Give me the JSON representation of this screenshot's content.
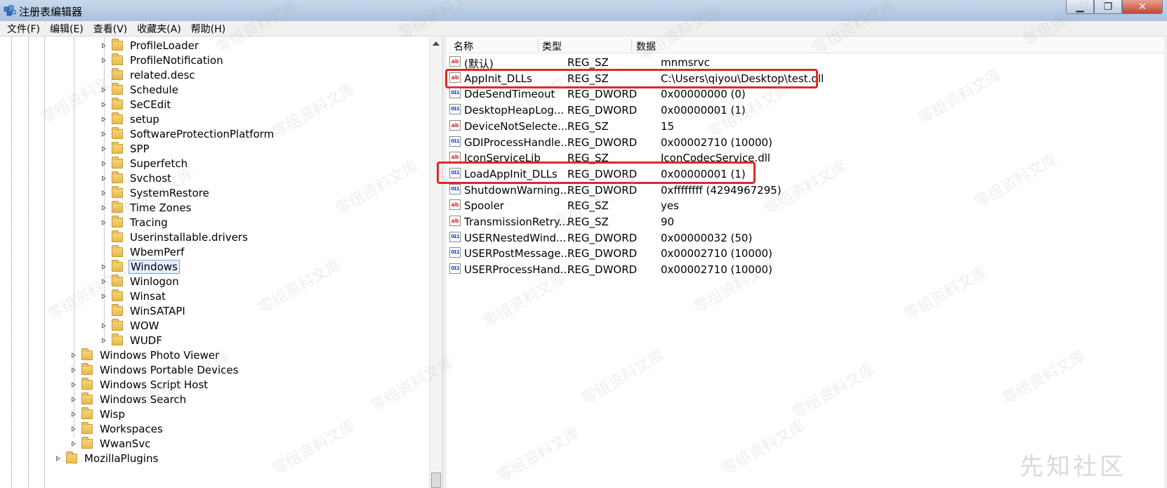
{
  "window": {
    "title": "注册表编辑器",
    "controls": {
      "minimize": "▁",
      "maximize": "❐",
      "close": "✕"
    }
  },
  "menu": [
    "文件(F)",
    "编辑(E)",
    "查看(V)",
    "收藏夹(A)",
    "帮助(H)"
  ],
  "tree": {
    "items": [
      {
        "label": "ProfileLoader",
        "expander": "closed"
      },
      {
        "label": "ProfileNotification",
        "expander": "closed"
      },
      {
        "label": "related.desc",
        "expander": "none"
      },
      {
        "label": "Schedule",
        "expander": "closed"
      },
      {
        "label": "SeCEdit",
        "expander": "closed"
      },
      {
        "label": "setup",
        "expander": "closed"
      },
      {
        "label": "SoftwareProtectionPlatform",
        "expander": "closed"
      },
      {
        "label": "SPP",
        "expander": "closed"
      },
      {
        "label": "Superfetch",
        "expander": "closed"
      },
      {
        "label": "Svchost",
        "expander": "closed"
      },
      {
        "label": "SystemRestore",
        "expander": "closed"
      },
      {
        "label": "Time Zones",
        "expander": "closed"
      },
      {
        "label": "Tracing",
        "expander": "closed"
      },
      {
        "label": "Userinstallable.drivers",
        "expander": "none"
      },
      {
        "label": "WbemPerf",
        "expander": "none"
      },
      {
        "label": "Windows",
        "expander": "closed",
        "selected": true
      },
      {
        "label": "Winlogon",
        "expander": "closed"
      },
      {
        "label": "Winsat",
        "expander": "closed"
      },
      {
        "label": "WinSATAPI",
        "expander": "none"
      },
      {
        "label": "WOW",
        "expander": "closed"
      },
      {
        "label": "WUDF",
        "expander": "closed"
      },
      {
        "label": "Windows Photo Viewer",
        "expander": "closed"
      },
      {
        "label": "Windows Portable Devices",
        "expander": "closed"
      },
      {
        "label": "Windows Script Host",
        "expander": "closed"
      },
      {
        "label": "Windows Search",
        "expander": "closed"
      },
      {
        "label": "Wisp",
        "expander": "closed"
      },
      {
        "label": "Workspaces",
        "expander": "closed"
      },
      {
        "label": "WwanSvc",
        "expander": "closed"
      },
      {
        "label": "MozillaPlugins",
        "expander": "closed"
      }
    ]
  },
  "list": {
    "headers": {
      "name": "名称",
      "type": "类型",
      "data": "数据"
    },
    "rows": [
      {
        "name": "(默认)",
        "type": "REG_SZ",
        "data": "mnmsrvc",
        "icon": "ab"
      },
      {
        "name": "AppInit_DLLs",
        "type": "REG_SZ",
        "data": "C:\\Users\\qiyou\\Desktop\\test.dll",
        "icon": "ab",
        "highlighted": true
      },
      {
        "name": "DdeSendTimeout",
        "type": "REG_DWORD",
        "data": "0x00000000 (0)",
        "icon": "011"
      },
      {
        "name": "DesktopHeapLog...",
        "type": "REG_DWORD",
        "data": "0x00000001 (1)",
        "icon": "011"
      },
      {
        "name": "DeviceNotSelecte...",
        "type": "REG_SZ",
        "data": "15",
        "icon": "ab"
      },
      {
        "name": "GDIProcessHandle...",
        "type": "REG_DWORD",
        "data": "0x00002710 (10000)",
        "icon": "011"
      },
      {
        "name": "IconServiceLib",
        "type": "REG_SZ",
        "data": "IconCodecService.dll",
        "icon": "ab"
      },
      {
        "name": "LoadAppInit_DLLs",
        "type": "REG_DWORD",
        "data": "0x00000001 (1)",
        "icon": "011",
        "highlighted": true
      },
      {
        "name": "ShutdownWarning...",
        "type": "REG_DWORD",
        "data": "0xffffffff (4294967295)",
        "icon": "011"
      },
      {
        "name": "Spooler",
        "type": "REG_SZ",
        "data": "yes",
        "icon": "ab"
      },
      {
        "name": "TransmissionRetry...",
        "type": "REG_SZ",
        "data": "90",
        "icon": "ab"
      },
      {
        "name": "USERNestedWind...",
        "type": "REG_DWORD",
        "data": "0x00000032 (50)",
        "icon": "011"
      },
      {
        "name": "USERPostMessage...",
        "type": "REG_DWORD",
        "data": "0x00002710 (10000)",
        "icon": "011"
      },
      {
        "name": "USERProcessHand...",
        "type": "REG_DWORD",
        "data": "0x00002710 (10000)",
        "icon": "011"
      }
    ]
  },
  "watermark": "零组资料文库",
  "corner_logo": "先知社区",
  "colors": {
    "highlight": "#e12727",
    "selection": "#e5efff",
    "folder": "#e9b94b"
  }
}
